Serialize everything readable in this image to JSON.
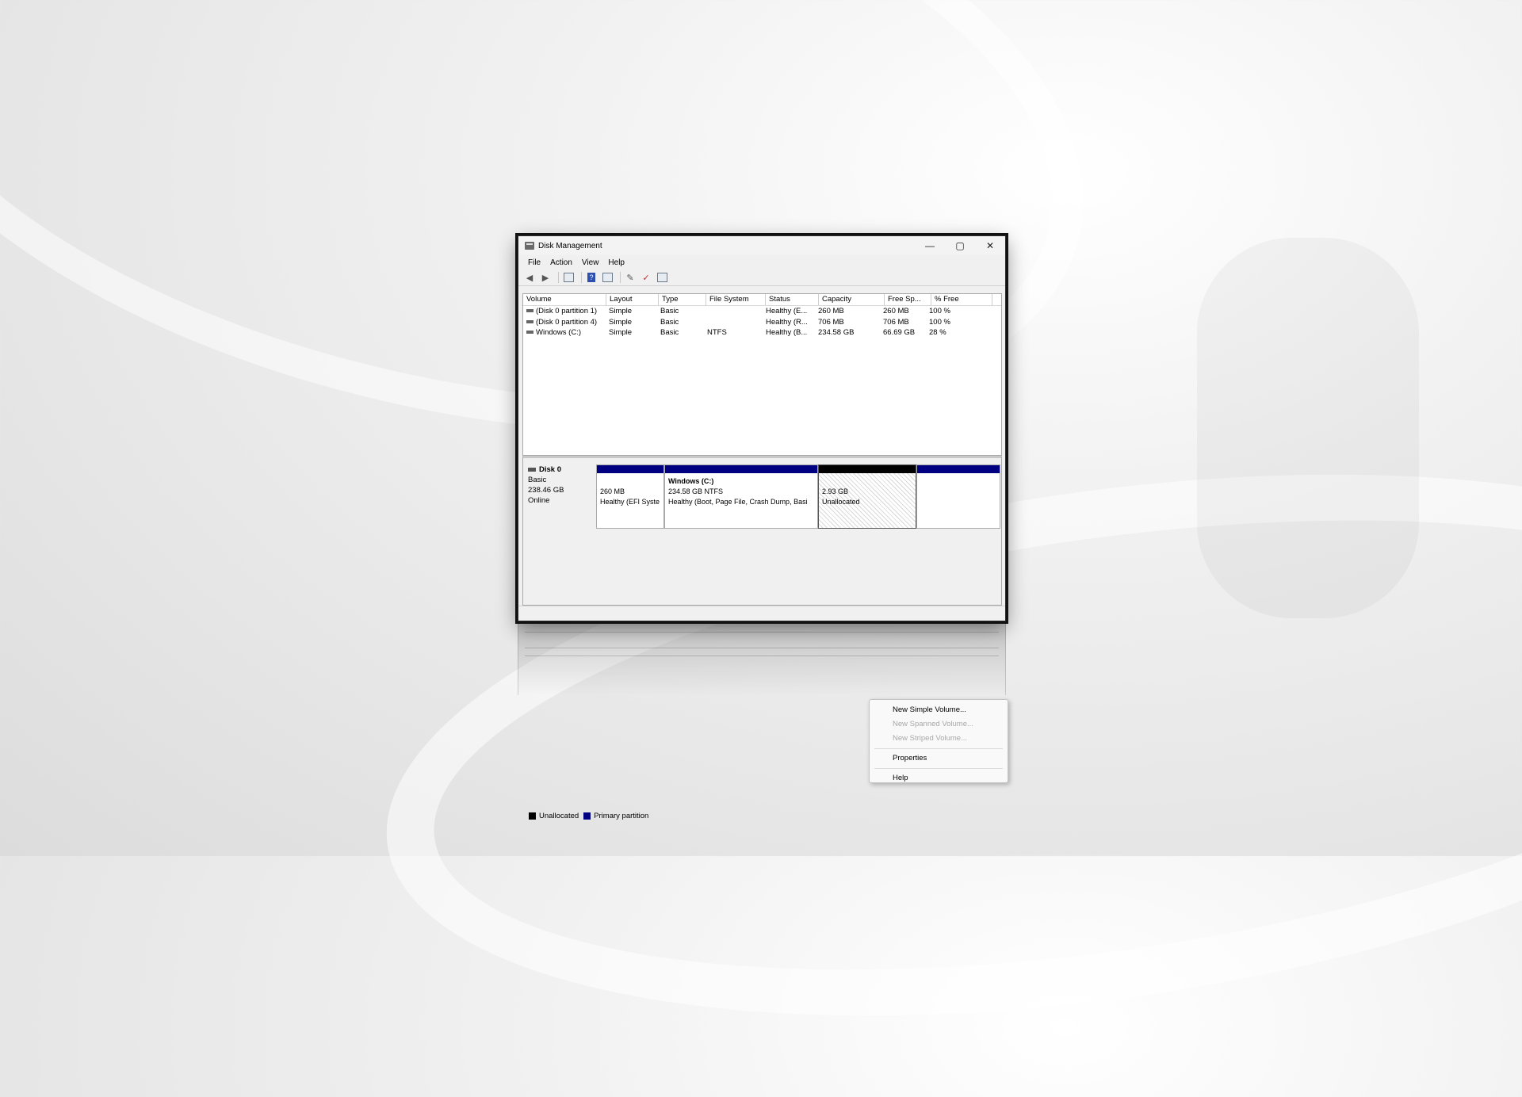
{
  "window": {
    "title": "Disk Management",
    "minimize": "—",
    "maximize": "▢",
    "close": "✕"
  },
  "menu": [
    "File",
    "Action",
    "View",
    "Help"
  ],
  "toolbar": {
    "icons": [
      "back-arrow-icon",
      "forward-arrow-icon",
      "console-tree-icon",
      "help-icon",
      "properties-icon",
      "rescan-icon",
      "check-icon",
      "refresh-icon"
    ],
    "back": "◀",
    "forward": "▶",
    "help": "?",
    "rescan": "✎",
    "check": "✓"
  },
  "volume_list": {
    "columns": [
      "Volume",
      "Layout",
      "Type",
      "File System",
      "Status",
      "Capacity",
      "Free Sp...",
      "% Free"
    ],
    "rows": [
      [
        "(Disk 0 partition 1)",
        "Simple",
        "Basic",
        "",
        "Healthy (E...",
        "260 MB",
        "260 MB",
        "100 %"
      ],
      [
        "(Disk 0 partition 4)",
        "Simple",
        "Basic",
        "",
        "Healthy (R...",
        "706 MB",
        "706 MB",
        "100 %"
      ],
      [
        "Windows (C:)",
        "Simple",
        "Basic",
        "NTFS",
        "Healthy (B...",
        "234.58 GB",
        "66.69 GB",
        "28 %"
      ]
    ]
  },
  "disk": {
    "name": "Disk 0",
    "type": "Basic",
    "size": "238.46 GB",
    "state": "Online",
    "partitions": [
      {
        "line1": "",
        "line2": "260 MB",
        "line3": "Healthy (EFI Syste",
        "bar_color": "#000080"
      },
      {
        "line1": "Windows  (C:)",
        "line2": "234.58 GB NTFS",
        "line3": "Healthy (Boot, Page File, Crash Dump, Basi",
        "bar_color": "#000080"
      },
      {
        "line1": "",
        "line2": "2.93 GB",
        "line3": "Unallocated",
        "bar_color": "#000000"
      },
      {
        "line1": "",
        "line2": "",
        "line3": "",
        "bar_color": "#000080"
      }
    ]
  },
  "legend": [
    {
      "label": "Unallocated",
      "color": "#000000"
    },
    {
      "label": "Primary partition",
      "color": "#000080"
    }
  ],
  "context_menu": {
    "items": [
      {
        "label": "New Simple Volume...",
        "enabled": true
      },
      {
        "label": "New Spanned Volume...",
        "enabled": false
      },
      {
        "label": "New Striped Volume...",
        "enabled": false
      },
      {
        "label": "Properties",
        "enabled": true
      },
      {
        "label": "Help",
        "enabled": true
      }
    ]
  },
  "colors": {
    "primary_partition": "#000080",
    "unallocated": "#000000",
    "window_bg": "#f0f0f0"
  }
}
